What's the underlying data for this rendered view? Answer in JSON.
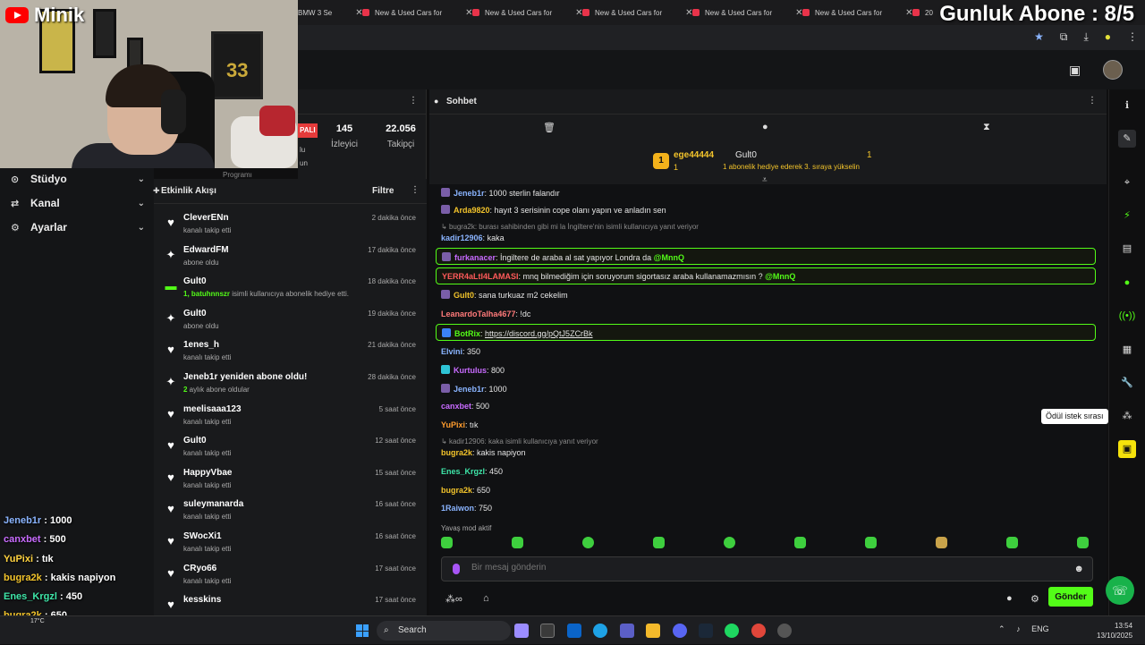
{
  "overlay": {
    "channel_name": "Minik",
    "sub_goal": "Gunluk Abone : 8/5"
  },
  "browser": {
    "tabs": [
      "BMW 3 Se",
      "New & Used Cars for",
      "New & Used Cars for",
      "New & Used Cars for",
      "New & Used Cars for",
      "New & Used Cars for",
      "20"
    ]
  },
  "left_nav": {
    "items": [
      {
        "label": "Stüdyo",
        "icon": "studio-icon"
      },
      {
        "label": "Kanal",
        "icon": "channel-icon"
      },
      {
        "label": "Ayarlar",
        "icon": "gear-icon"
      }
    ]
  },
  "overlay_chat": [
    {
      "user": "Jeneb1r",
      "msg": "1000",
      "color": "#8ab4ff"
    },
    {
      "user": "canxbet",
      "msg": "500",
      "color": "#c86bff"
    },
    {
      "user": "YuPixi",
      "msg": "tık",
      "color": "#ffd23f"
    },
    {
      "user": "bugra2k",
      "msg": "kakis napiyon",
      "color": "#f3c42b"
    },
    {
      "user": "Enes_Krgzl",
      "msg": "450",
      "color": "#3ee6a8"
    },
    {
      "user": "bugra2k",
      "msg": "650",
      "color": "#f3c42b"
    },
    {
      "user": "1Raiwon",
      "msg": "750",
      "color": "#8ab4ff"
    }
  ],
  "stats": {
    "live_badge": "PALI",
    "viewers": {
      "value": "145",
      "label": "İzleyici"
    },
    "followers": {
      "value": "22.056",
      "label": "Takipçi"
    },
    "partial_labels": [
      "lu",
      "un",
      "Programı"
    ]
  },
  "activity": {
    "title": "Etkinlik Akışı",
    "filter": "Filtre",
    "items": [
      {
        "name": "CleverENn",
        "sub": "kanalı takip etti",
        "time": "2 dakika önce",
        "icon": "heart"
      },
      {
        "name": "EdwardFM",
        "sub": "abone oldu",
        "time": "17 dakika önce",
        "icon": "star"
      },
      {
        "name": "Gult0",
        "sub_highlight": "1, batuhnnszr",
        "sub": " isimli kullanıcıya abonelik hediye etti.",
        "time": "18 dakika önce",
        "icon": "gift"
      },
      {
        "name": "Gult0",
        "sub": "abone oldu",
        "time": "19 dakika önce",
        "icon": "star"
      },
      {
        "name": "1enes_h",
        "sub": "kanalı takip etti",
        "time": "21 dakika önce",
        "icon": "heart"
      },
      {
        "name": "Jeneb1r yeniden abone oldu!",
        "sub_highlight": "2",
        "sub": " aylık abone oldular",
        "time": "28 dakika önce",
        "icon": "star"
      },
      {
        "name": "meelisaaa123",
        "sub": "kanalı takip etti",
        "time": "5 saat önce",
        "icon": "heart"
      },
      {
        "name": "Gult0",
        "sub": "kanalı takip etti",
        "time": "12 saat önce",
        "icon": "heart"
      },
      {
        "name": "HappyVbae",
        "sub": "kanalı takip etti",
        "time": "15 saat önce",
        "icon": "heart"
      },
      {
        "name": "suleymanarda",
        "sub": "kanalı takip etti",
        "time": "16 saat önce",
        "icon": "heart"
      },
      {
        "name": "SWocXi1",
        "sub": "kanalı takip etti",
        "time": "16 saat önce",
        "icon": "heart"
      },
      {
        "name": "CRyo66",
        "sub": "kanalı takip etti",
        "time": "17 saat önce",
        "icon": "heart"
      },
      {
        "name": "kesskins",
        "sub": "",
        "time": "17 saat önce",
        "icon": "heart"
      }
    ]
  },
  "chat": {
    "title": "Sohbet",
    "pinned": {
      "user1": "ege44444",
      "count1": "1",
      "user2": "Gult0",
      "count2": "1",
      "message": "1 abonelik hediye ederek 3. sıraya yükselin"
    },
    "messages": [
      {
        "user": "Jeneb1r",
        "text": "1000 sterlin falandır",
        "color": "#8ab4ff",
        "badge": true
      },
      {
        "user": "Arda9820",
        "text": "hayıt 3 serisinin cope olanı yapın ve anladın sen",
        "color": "#f3c42b",
        "badge": true
      },
      {
        "reply": "bugra2k: burası sahibinden gibi mi la İngiltere'nin isimli kullanıcıya yanıt veriyor"
      },
      {
        "user": "kadir12906",
        "text": "kaka",
        "color": "#8ab4ff"
      },
      {
        "user": "furkanacer",
        "text": "İngiltere de araba al sat yapıyor Londra da ",
        "mention": "@MnnQ",
        "color": "#c86bff",
        "badge": true,
        "highlight": true
      },
      {
        "user": "YERR4aLtI4LAMASI",
        "text": "mnq bilmediğim için soruyorum sigortasız araba kullanamazmısın ? ",
        "mention": "@MnnQ",
        "color": "#ff5a5a",
        "highlight": true
      },
      {
        "user": "Gult0",
        "text": "sana turkuaz m2 cekelim",
        "color": "#f3c42b",
        "badge": true
      },
      {
        "user": "LeanardoTalha4677",
        "text": "!dc",
        "color": "#ff7a7a"
      },
      {
        "user": "BotRix",
        "text": "https://discord.gg/pQtJ5ZCrBk",
        "color": "#53fc18",
        "badge": true,
        "highlight": true,
        "link": true
      },
      {
        "user": "Elvini",
        "text": "350",
        "color": "#8ab4ff"
      },
      {
        "user": "Kurtulus",
        "text": "800",
        "color": "#c86bff",
        "badge": true
      },
      {
        "user": "Jeneb1r",
        "text": "1000",
        "color": "#8ab4ff",
        "badge": true
      },
      {
        "user": "canxbet",
        "text": "500",
        "color": "#c86bff"
      },
      {
        "user": "YuPixi",
        "text": "tık",
        "color": "#ff9d2e"
      },
      {
        "reply": "kadir12906: kaka isimli kullanıcıya yanıt veriyor"
      },
      {
        "user": "bugra2k",
        "text": "kakis napiyon",
        "color": "#f3c42b"
      },
      {
        "user": "Enes_Krgzl",
        "text": "450",
        "color": "#3ee6a8"
      },
      {
        "user": "bugra2k",
        "text": "650",
        "color": "#f3c42b"
      },
      {
        "user": "1Raiwon",
        "text": "750",
        "color": "#8ab4ff"
      }
    ],
    "slow_mode": "Yavaş mod aktif",
    "input_placeholder": "Bir mesaj gönderin",
    "send_label": "Gönder"
  },
  "right_rail": {
    "tooltip": "Ödül istek sırası"
  },
  "taskbar": {
    "search": "Search",
    "lang": "ENG",
    "time": "13:54",
    "date": "13/10/2025",
    "weather": "17°C"
  },
  "colors": {
    "accent": "#53fc18",
    "live": "#e53b3b",
    "gold": "#f3c42b"
  }
}
